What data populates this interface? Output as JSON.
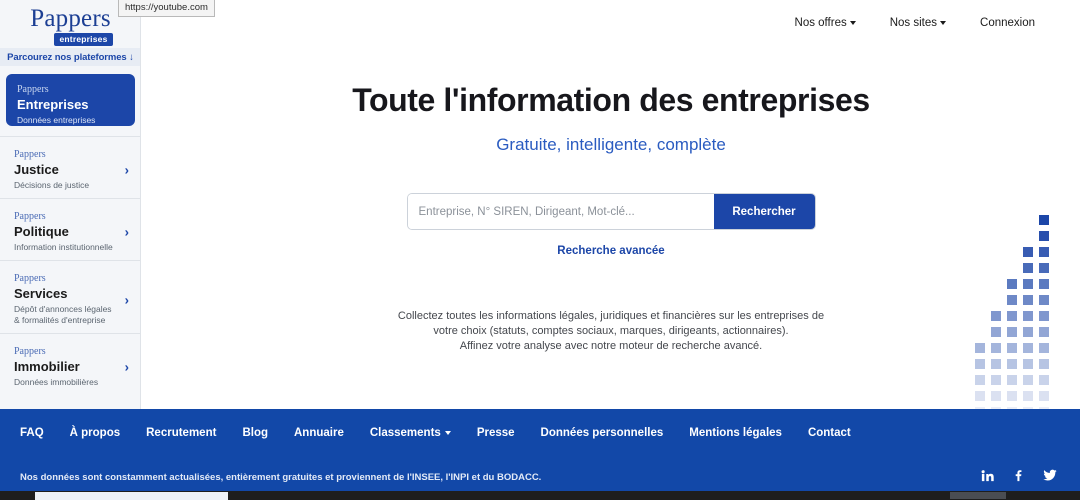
{
  "tooltip": {
    "url": "https://youtube.com"
  },
  "logo": {
    "word": "Pappers",
    "badge": "entreprises"
  },
  "sidebar": {
    "browse_label": "Parcourez nos plateformes",
    "browse_arrow": "↓",
    "items": [
      {
        "eyebrow": "Pappers",
        "title": "Entreprises",
        "sub": "Données entreprises",
        "active": true,
        "chevron": ""
      },
      {
        "eyebrow": "Pappers",
        "title": "Justice",
        "sub": "Décisions de justice",
        "active": false,
        "chevron": "›"
      },
      {
        "eyebrow": "Pappers",
        "title": "Politique",
        "sub": "Information institutionnelle",
        "active": false,
        "chevron": "›"
      },
      {
        "eyebrow": "Pappers",
        "title": "Services",
        "sub": "Dépôt d'annonces légales & formalités d'entreprise",
        "active": false,
        "chevron": "›"
      },
      {
        "eyebrow": "Pappers",
        "title": "Immobilier",
        "sub": "Données immobilières",
        "active": false,
        "chevron": "›"
      }
    ]
  },
  "topnav": {
    "items": [
      {
        "label": "Nos offres",
        "caret": true
      },
      {
        "label": "Nos sites",
        "caret": true
      },
      {
        "label": "Connexion",
        "caret": false
      }
    ]
  },
  "hero": {
    "title": "Toute l'information des entreprises",
    "subtitle": "Gratuite, intelligente, complète"
  },
  "search": {
    "placeholder": "Entreprise, N° SIREN, Dirigeant, Mot-clé...",
    "value": "",
    "button_label": "Rechercher",
    "advanced_label": "Recherche avancée"
  },
  "blurb": {
    "line1": "Collectez toutes les informations légales, juridiques et financières sur les entreprises de",
    "line2": "votre choix (statuts, comptes sociaux, marques, dirigeants, actionnaires).",
    "line3": "Affinez votre analyse avec notre moteur de recherche avancé."
  },
  "footer": {
    "links": [
      {
        "label": "FAQ",
        "caret": false
      },
      {
        "label": "À propos",
        "caret": false
      },
      {
        "label": "Recrutement",
        "caret": false
      },
      {
        "label": "Blog",
        "caret": false
      },
      {
        "label": "Annuaire",
        "caret": false
      },
      {
        "label": "Classements",
        "caret": true
      },
      {
        "label": "Presse",
        "caret": false
      },
      {
        "label": "Données personnelles",
        "caret": false
      },
      {
        "label": "Mentions légales",
        "caret": false
      },
      {
        "label": "Contact",
        "caret": false
      }
    ],
    "note": "Nos données sont constamment actualisées, entièrement gratuites et proviennent de l'INSEE, l'INPI et du BODACC.",
    "socials": [
      "linkedin-icon",
      "facebook-icon",
      "twitter-icon"
    ]
  },
  "decoration": {
    "dot_grid": {
      "columns": 5,
      "rows": 13,
      "description": "triangular stair-step grid of squares fading downward",
      "filled_columns_per_row": [
        1,
        1,
        2,
        2,
        3,
        3,
        4,
        4,
        5,
        5,
        5,
        5,
        5
      ],
      "row_opacity": [
        1,
        0.95,
        0.88,
        0.8,
        0.72,
        0.64,
        0.56,
        0.48,
        0.4,
        0.32,
        0.24,
        0.16,
        0.09
      ]
    }
  },
  "colors": {
    "brand_blue": "#1c46a8",
    "footer_blue": "#1248a8",
    "sidebar_bg": "#f4f6f9",
    "link_blue": "#2a5bc0"
  },
  "scrollbar": {
    "orientation": "horizontal"
  }
}
